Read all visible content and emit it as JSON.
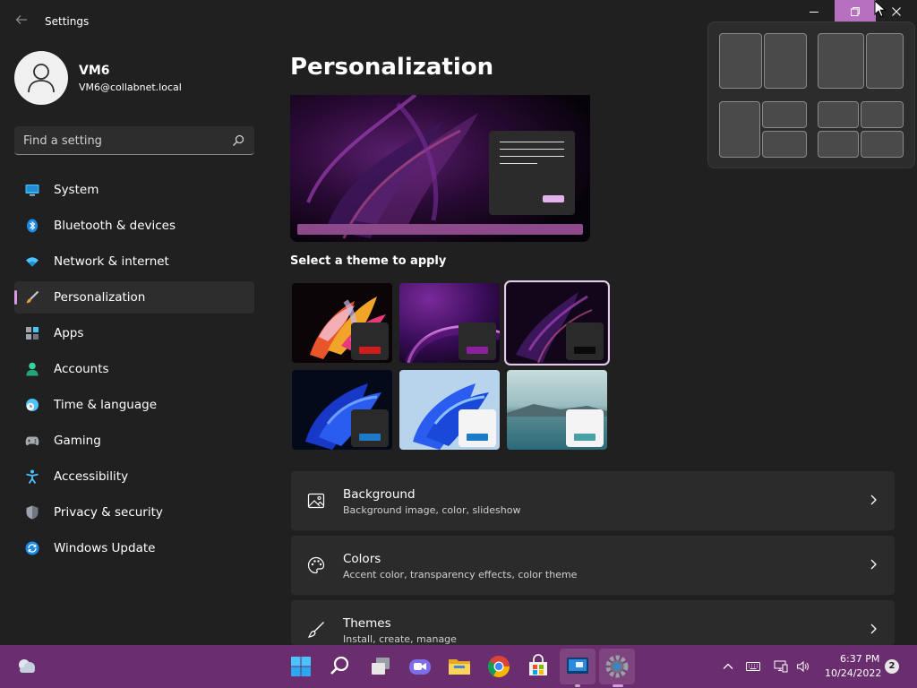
{
  "window": {
    "title": "Settings",
    "back_icon": "back-arrow-icon",
    "minimize_icon": "minimize-icon",
    "maximize_icon": "restore-icon",
    "close_icon": "close-icon"
  },
  "profile": {
    "name": "VM6",
    "email": "VM6@collabnet.local"
  },
  "search": {
    "placeholder": "Find a setting",
    "value": ""
  },
  "sidebar": {
    "items": [
      {
        "label": "System",
        "icon": "monitor-icon",
        "active": false
      },
      {
        "label": "Bluetooth & devices",
        "icon": "bluetooth-icon",
        "active": false
      },
      {
        "label": "Network & internet",
        "icon": "wifi-icon",
        "active": false
      },
      {
        "label": "Personalization",
        "icon": "brush-icon",
        "active": true
      },
      {
        "label": "Apps",
        "icon": "apps-icon",
        "active": false
      },
      {
        "label": "Accounts",
        "icon": "person-icon",
        "active": false
      },
      {
        "label": "Time & language",
        "icon": "clock-globe-icon",
        "active": false
      },
      {
        "label": "Gaming",
        "icon": "gamepad-icon",
        "active": false
      },
      {
        "label": "Accessibility",
        "icon": "accessibility-icon",
        "active": false
      },
      {
        "label": "Privacy & security",
        "icon": "shield-icon",
        "active": false
      },
      {
        "label": "Windows Update",
        "icon": "update-icon",
        "active": false
      }
    ]
  },
  "main": {
    "title": "Personalization",
    "theme_section_label": "Select a theme to apply",
    "themes": [
      {
        "name": "flower-theme",
        "accent": "#d01c1c",
        "selected": false
      },
      {
        "name": "glow-theme",
        "accent": "#8a1fa0",
        "selected": false
      },
      {
        "name": "captured-motion-theme",
        "accent": "#0a0a0a",
        "selected": true
      },
      {
        "name": "windows-dark-theme",
        "accent": "#1e7ac8",
        "selected": false
      },
      {
        "name": "windows-light-theme",
        "accent": "#1a7cc8",
        "selected": false
      },
      {
        "name": "sunrise-lake-theme",
        "accent": "#4aa0a8",
        "selected": false
      }
    ],
    "cards": [
      {
        "title": "Background",
        "subtitle": "Background image, color, slideshow",
        "icon": "image-icon"
      },
      {
        "title": "Colors",
        "subtitle": "Accent color, transparency effects, color theme",
        "icon": "palette-icon"
      },
      {
        "title": "Themes",
        "subtitle": "Install, create, manage",
        "icon": "brush-pen-icon"
      }
    ]
  },
  "taskbar": {
    "clock_time": "6:37 PM",
    "clock_date": "10/24/2022",
    "notification_count": "2",
    "icons": [
      "weather-icon",
      "start-icon",
      "search-icon",
      "task-view-icon",
      "chat-icon",
      "file-explorer-icon",
      "chrome-icon",
      "store-icon",
      "remote-desktop-icon",
      "settings-icon"
    ]
  },
  "colors": {
    "accent": "#d69be0",
    "taskbar": "#6a2e6e",
    "window_bg": "#202020"
  }
}
